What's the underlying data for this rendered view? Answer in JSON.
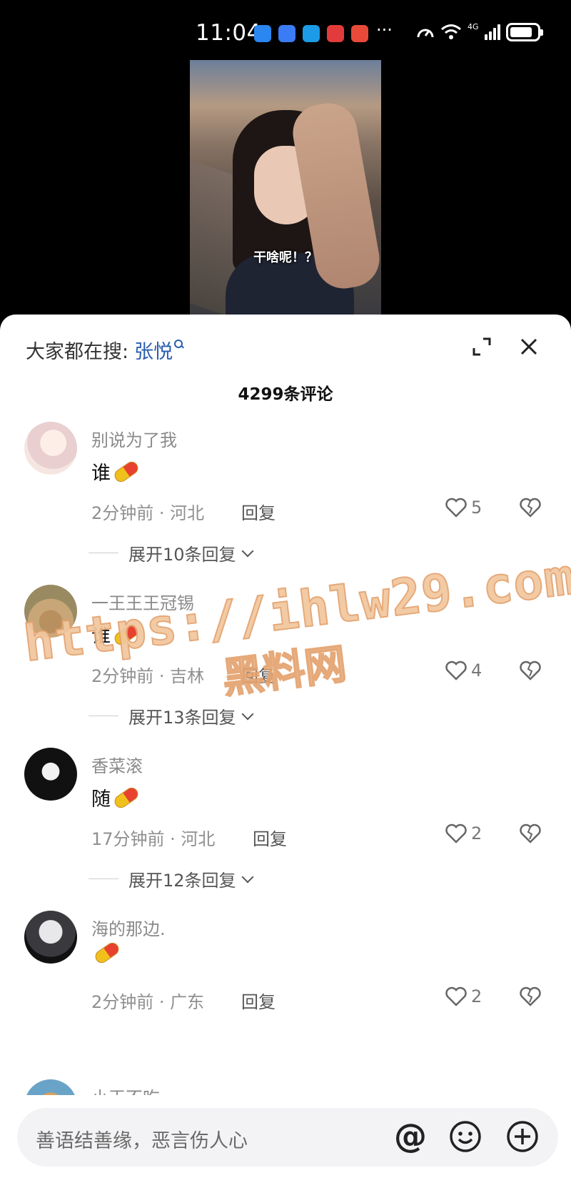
{
  "status_bar": {
    "time": "11:04",
    "more": "···",
    "network": "4G"
  },
  "video": {
    "caption": "干啥呢！？"
  },
  "sheet": {
    "search_prefix": "大家都在搜:",
    "search_term": "张悦",
    "comment_count": "4299条评论"
  },
  "comments": [
    {
      "user": "别说为了我",
      "text": "谁",
      "time_loc": "2分钟前 · 河北",
      "reply_label": "回复",
      "likes": "5",
      "expand": "展开10条回复"
    },
    {
      "user": "一王王王冠锡",
      "text": "谁",
      "time_loc": "2分钟前 · 吉林",
      "reply_label": "回复",
      "likes": "4",
      "expand": "展开13条回复"
    },
    {
      "user": "香菜滚",
      "text": "随",
      "time_loc": "17分钟前 · 河北",
      "reply_label": "回复",
      "likes": "2",
      "expand": "展开12条回复"
    },
    {
      "user": "海的那边.",
      "text": "",
      "time_loc": "2分钟前 · 广东",
      "reply_label": "回复",
      "likes": "2"
    }
  ],
  "partial_comment": {
    "user": "小王不吃"
  },
  "input": {
    "placeholder": "善语结善缘，恶言伤人心",
    "at_symbol": "@"
  },
  "watermark": {
    "url": "https://ihlw29.com",
    "name": "黑料网"
  },
  "colors": {
    "link_blue": "#2a5db0",
    "watermark": "#f1c79e"
  }
}
